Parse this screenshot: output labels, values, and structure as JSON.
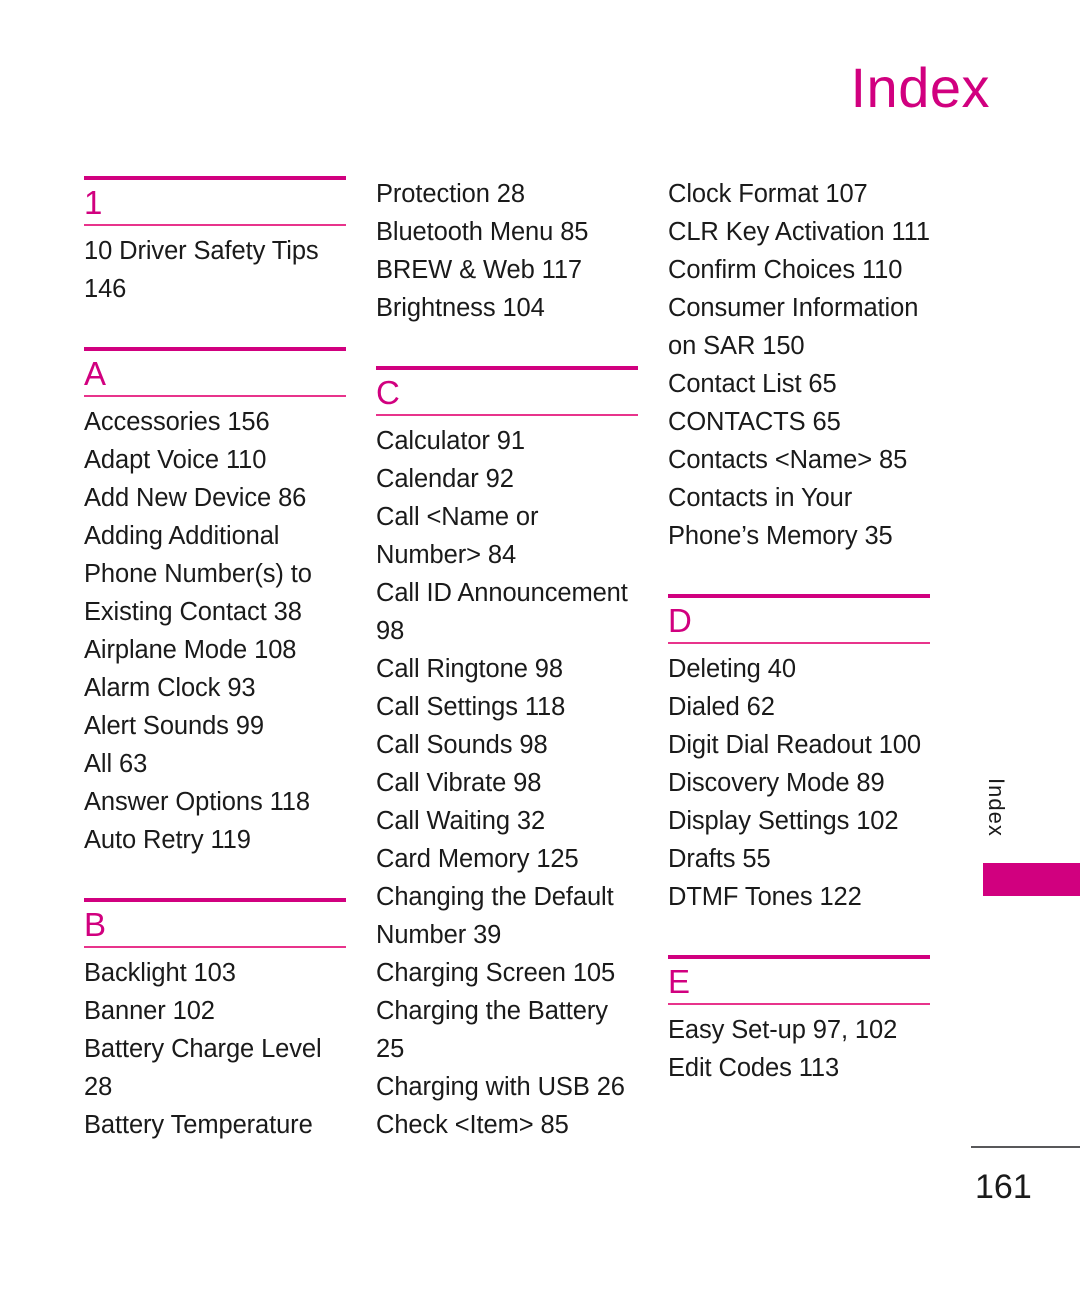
{
  "header": {
    "title": "Index"
  },
  "side_tab": {
    "label": "Index"
  },
  "footer": {
    "page_number": "161"
  },
  "colors": {
    "accent": "#D1007F",
    "accent_light": "#E8348C",
    "text": "#1a1a1a",
    "footer_rule": "#58585a"
  },
  "columns": [
    {
      "groups": [
        {
          "letter": "1",
          "has_heading": true,
          "entries": [
            "10 Driver Safety Tips 146"
          ]
        },
        {
          "letter": "A",
          "has_heading": true,
          "entries": [
            "Accessories 156",
            "Adapt Voice 110",
            "Add New Device 86",
            "Adding Additional Phone Number(s) to Existing Contact 38",
            "Airplane Mode 108",
            "Alarm Clock 93",
            "Alert Sounds 99",
            "All 63",
            "Answer Options 118",
            "Auto Retry 119"
          ]
        },
        {
          "letter": "B",
          "has_heading": true,
          "entries": [
            "Backlight 103",
            "Banner 102",
            "Battery Charge Level 28",
            "Battery Temperature"
          ]
        }
      ]
    },
    {
      "groups": [
        {
          "letter": "",
          "has_heading": false,
          "entries": [
            "Protection 28",
            "Bluetooth Menu 85",
            "BREW & Web 117",
            "Brightness 104"
          ]
        },
        {
          "letter": "C",
          "has_heading": true,
          "entries": [
            "Calculator 91",
            "Calendar 92",
            "Call <Name or Number> 84",
            "Call ID Announcement 98",
            "Call Ringtone 98",
            "Call Settings 118",
            "Call Sounds 98",
            "Call Vibrate 98",
            "Call Waiting 32",
            "Card Memory 125",
            "Changing the Default Number 39",
            "Charging Screen 105",
            "Charging the Battery 25",
            "Charging with USB 26",
            "Check <Item> 85"
          ]
        }
      ]
    },
    {
      "groups": [
        {
          "letter": "",
          "has_heading": false,
          "entries": [
            "Clock Format 107",
            "CLR Key Activation 111",
            "Confirm Choices 110",
            "Consumer Information on SAR 150",
            "Contact List 65",
            "CONTACTS 65",
            "Contacts <Name> 85",
            "Contacts in Your Phone’s Memory 35"
          ]
        },
        {
          "letter": "D",
          "has_heading": true,
          "entries": [
            "Deleting 40",
            "Dialed 62",
            "Digit Dial Readout 100",
            "Discovery Mode 89",
            "Display Settings 102",
            "Drafts 55",
            "DTMF Tones 122"
          ]
        },
        {
          "letter": "E",
          "has_heading": true,
          "entries": [
            "Easy Set-up 97, 102",
            "Edit Codes 113"
          ]
        }
      ]
    }
  ]
}
